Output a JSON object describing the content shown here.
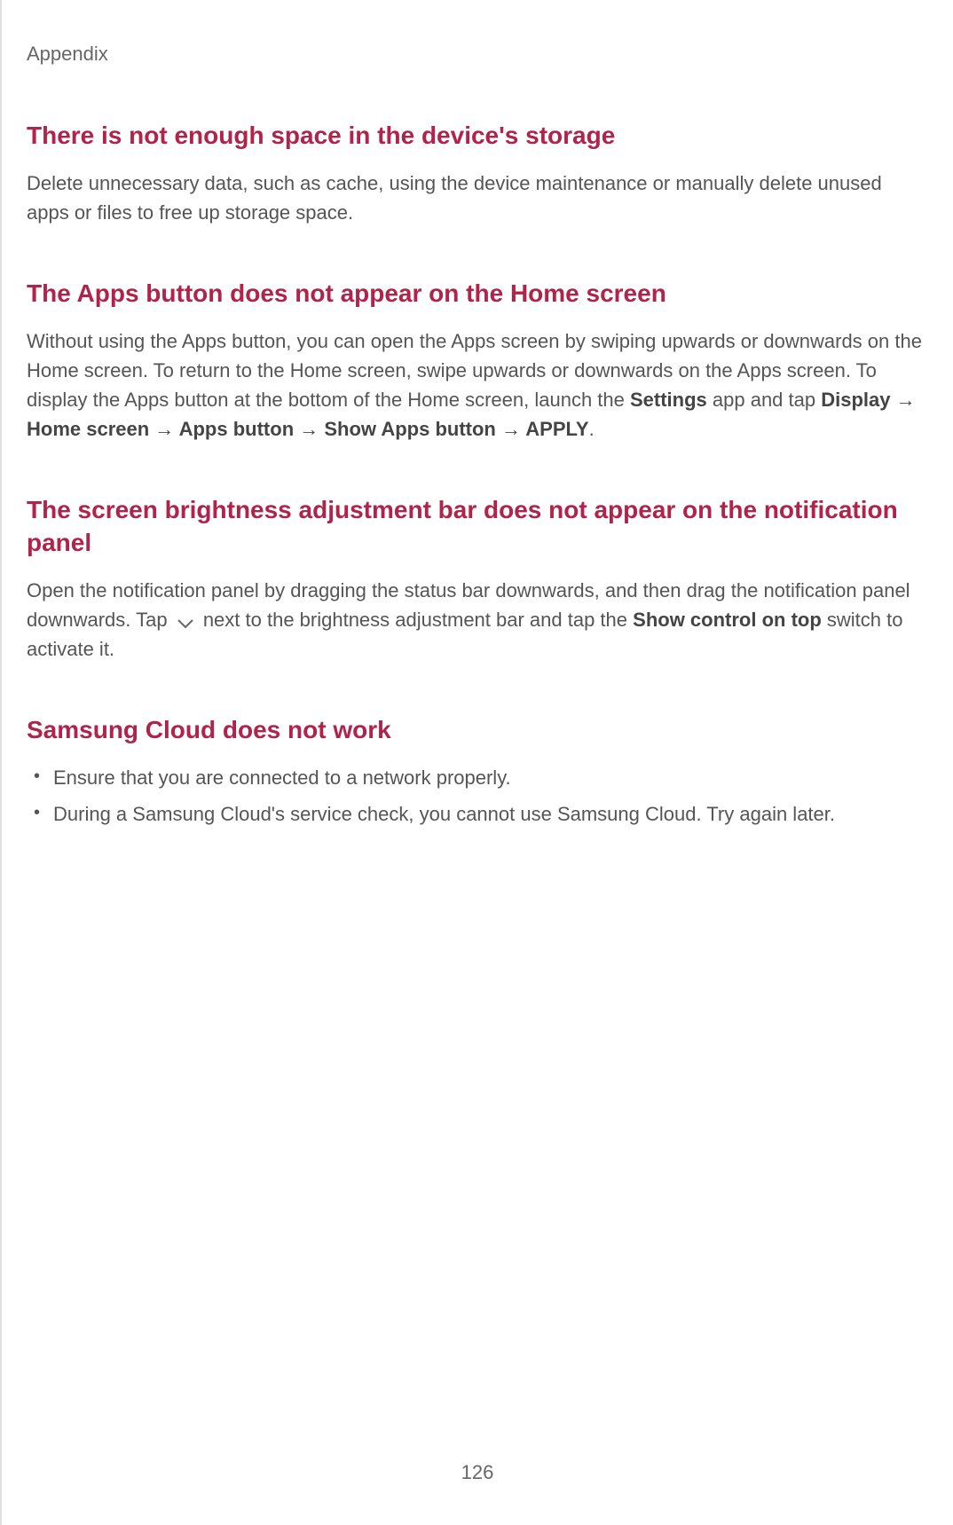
{
  "header": {
    "section_label": "Appendix"
  },
  "sections": {
    "storage": {
      "title": "There is not enough space in the device's storage",
      "body": "Delete unnecessary data, such as cache, using the device maintenance or manually delete unused apps or files to free up storage space."
    },
    "apps_button": {
      "title": "The Apps button does not appear on the Home screen",
      "body_pre": "Without using the Apps button, you can open the Apps screen by swiping upwards or downwards on the Home screen. To return to the Home screen, swipe upwards or downwards on the Apps screen. To display the Apps button at the bottom of the Home screen, launch the ",
      "b1": "Settings",
      "body_mid1": " app and tap ",
      "b2": "Display",
      "arrow": " → ",
      "b3": "Home screen",
      "b4": "Apps button",
      "b5": "Show Apps button",
      "b6": "APPLY",
      "period": "."
    },
    "brightness": {
      "title": "The screen brightness adjustment bar does not appear on the notification panel",
      "body_pre": "Open the notification panel by dragging the status bar downwards, and then drag the notification panel downwards. Tap ",
      "body_post": " next to the brightness adjustment bar and tap the ",
      "b1": "Show control on top",
      "body_end": " switch to activate it."
    },
    "cloud": {
      "title": "Samsung Cloud does not work",
      "item1": "Ensure that you are connected to a network properly.",
      "item2": "During a Samsung Cloud's service check, you cannot use Samsung Cloud. Try again later."
    }
  },
  "page_number": "126"
}
